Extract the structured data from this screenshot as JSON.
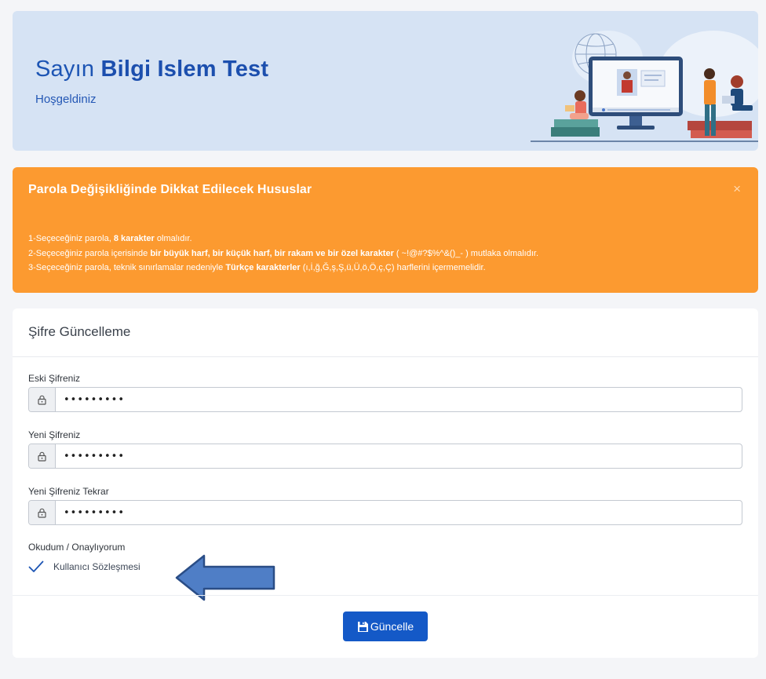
{
  "welcome": {
    "salutation": "Sayın",
    "user_name": "Bilgi Islem Test",
    "subtitle": "Hoşgeldiniz"
  },
  "alert": {
    "title": "Parola Değişikliğinde Dikkat Edilecek Hususlar",
    "close_icon": "×",
    "rule1": {
      "before": "1-Seçeceğiniz parola, ",
      "bold": "8 karakter",
      "after": " olmalıdır."
    },
    "rule2": {
      "before": "2-Seçeceğiniz parola içerisinde ",
      "bold": "bir büyük harf, bir küçük harf, bir rakam ve bir özel karakter",
      "after": " ( ~!@#?$%^&()_- ) mutlaka olmalıdır."
    },
    "rule3": {
      "before": "3-Seçeceğiniz parola, teknik sınırlamalar nedeniyle ",
      "bold": "Türkçe karakterler",
      "after": " (ı,İ,ğ,Ğ,ş,Ş,ü,Ü,ö,Ö,ç,Ç) harflerini içermemelidir."
    }
  },
  "form": {
    "title": "Şifre Güncelleme",
    "old_password": {
      "label": "Eski Şifreniz",
      "value": "•••••••••"
    },
    "new_password": {
      "label": "Yeni Şifreniz",
      "value": "•••••••••"
    },
    "new_password_repeat": {
      "label": "Yeni Şifreniz Tekrar",
      "value": "•••••••••"
    },
    "consent": {
      "caption": "Okudum / Onaylıyorum",
      "link": "Kullanıcı Sözleşmesi",
      "checked": true
    },
    "submit_label": "Güncelle"
  },
  "colors": {
    "brand_blue": "#1459c7",
    "warning_orange": "#fc9a30",
    "banner_bg": "#d6e3f4"
  }
}
